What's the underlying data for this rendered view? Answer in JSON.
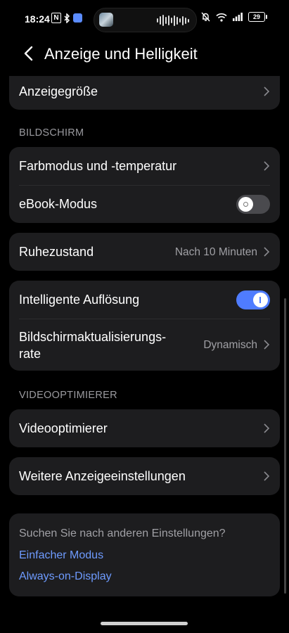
{
  "status_bar": {
    "time": "18:24",
    "nfc_letter": "N",
    "battery": "29"
  },
  "header": {
    "title": "Anzeige und Helligkeit"
  },
  "items": {
    "display_size": "Anzeigegröße",
    "color_mode": "Farbmodus und -temperatur",
    "ebook_mode": "eBook-Modus",
    "ebook_mode_state": "off",
    "sleep": "Ruhezustand",
    "sleep_value": "Nach 10 Minuten",
    "smart_resolution": "Intelligente Auflösung",
    "smart_resolution_state": "on",
    "refresh_rate_line1": "Bildschirmaktualisierungs-",
    "refresh_rate_line2": "rate",
    "refresh_rate_value": "Dynamisch",
    "video_optimizer": "Videooptimierer",
    "more_display": "Weitere Anzeigeeinstellungen"
  },
  "sections": {
    "screen": "BILDSCHIRM",
    "video": "VIDEOOPTIMIERER"
  },
  "suggestions": {
    "prompt": "Suchen Sie nach anderen Einstellungen?",
    "link1": "Einfacher Modus",
    "link2": "Always-on-Display"
  },
  "colors": {
    "accent": "#4f7cff",
    "link": "#6e9bff",
    "card": "#1d1d1f"
  }
}
